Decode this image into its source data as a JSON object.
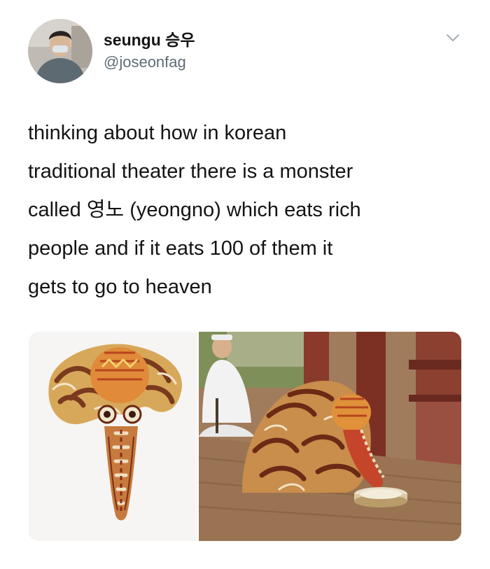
{
  "user": {
    "display_name": "seungu 승우",
    "handle": "@joseonfag"
  },
  "menu": {
    "icon": "chevron-down-icon"
  },
  "tweet": {
    "text_lines": [
      "thinking about how in korean",
      "traditional theater there is a monster",
      "called 영노 (yeongno) which eats rich",
      "people and if it eats 100 of them it",
      "gets to go to heaven"
    ]
  },
  "media": {
    "count": 2
  },
  "colors": {
    "handle": "#5f6b76",
    "text": "#141414",
    "chevron": "#9aa4ad"
  }
}
